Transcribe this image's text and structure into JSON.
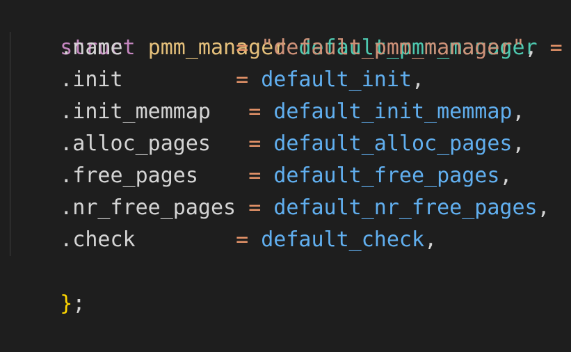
{
  "colors": {
    "background": "#1e1e1e",
    "keyword": "#c586c0",
    "type": "#e5c07b",
    "variable": "#4ec9b0",
    "operator": "#e8956a",
    "brace": "#ffd700",
    "string": "#ce9178",
    "function": "#61afef",
    "field": "#d4d4d4",
    "punctuation": "#d4d4d4"
  },
  "code": {
    "header": {
      "keyword": "struct",
      "type": "pmm_manager",
      "variable": "default_pmm_manager",
      "assign": "=",
      "open_brace": "{"
    },
    "fields": [
      {
        "field": ".name",
        "pad": "         ",
        "assign": "=",
        "value": "\"default_pmm_manager\"",
        "value_kind": "string",
        "comma": ","
      },
      {
        "field": ".init",
        "pad": "         ",
        "assign": "=",
        "value": "default_init",
        "value_kind": "function",
        "comma": ","
      },
      {
        "field": ".init_memmap",
        "pad": "   ",
        "assign": "=",
        "value": "default_init_memmap",
        "value_kind": "function",
        "comma": ","
      },
      {
        "field": ".alloc_pages",
        "pad": "   ",
        "assign": "=",
        "value": "default_alloc_pages",
        "value_kind": "function",
        "comma": ","
      },
      {
        "field": ".free_pages",
        "pad": "    ",
        "assign": "=",
        "value": "default_free_pages",
        "value_kind": "function",
        "comma": ","
      },
      {
        "field": ".nr_free_pages",
        "pad": " ",
        "assign": "=",
        "value": "default_nr_free_pages",
        "value_kind": "function",
        "comma": ","
      },
      {
        "field": ".check",
        "pad": "        ",
        "assign": "=",
        "value": "default_check",
        "value_kind": "function",
        "comma": ","
      }
    ],
    "footer": {
      "close_brace": "}",
      "semicolon": ";"
    }
  }
}
